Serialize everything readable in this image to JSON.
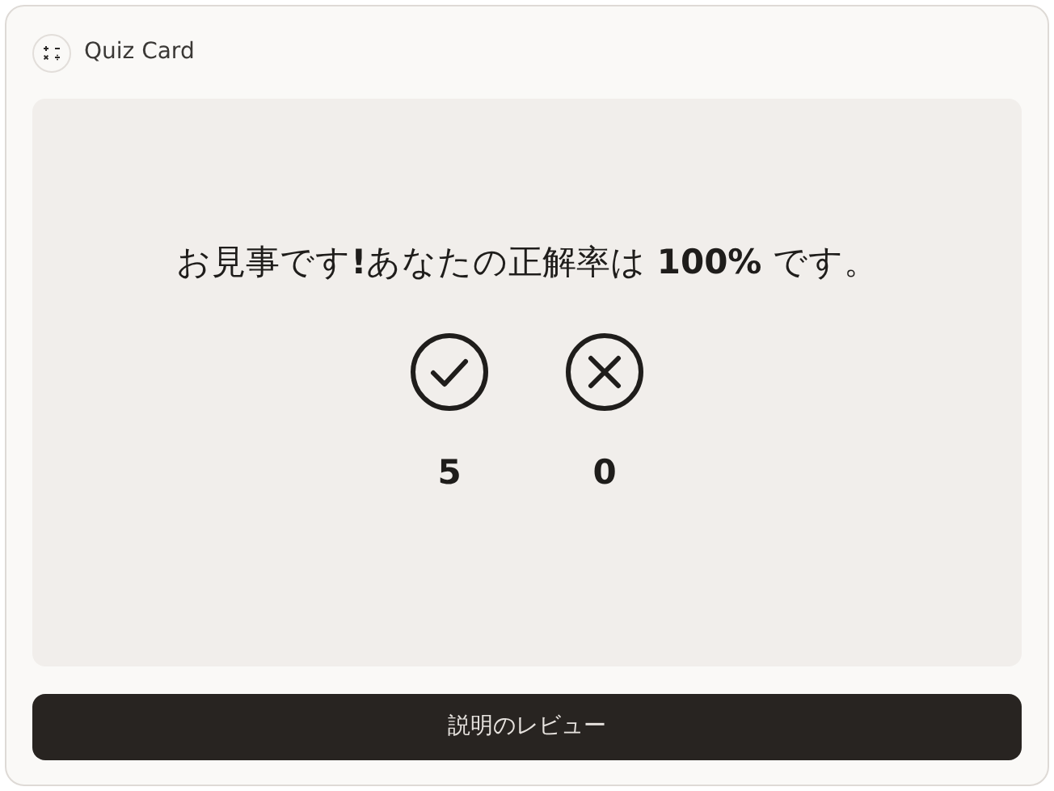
{
  "header": {
    "title": "Quiz Card"
  },
  "result": {
    "message": "お見事です**!**あなたの正解率は **100%** です。",
    "tallies": [
      {
        "kind": "correct",
        "count": "5"
      },
      {
        "kind": "incorrect",
        "count": "0"
      }
    ]
  },
  "review_button": {
    "label": "説明のレビュー"
  }
}
